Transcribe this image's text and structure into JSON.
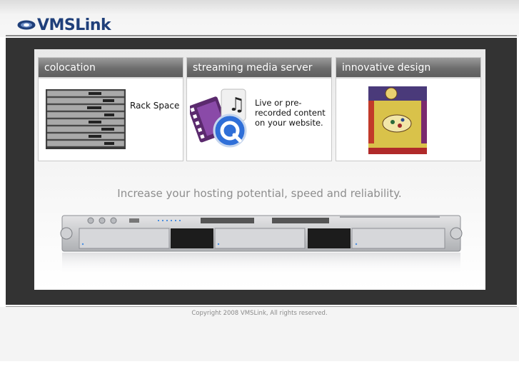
{
  "logo": {
    "text": "VMSLink"
  },
  "boxes": [
    {
      "title": "colocation",
      "caption": "Rack Space"
    },
    {
      "title": "streaming media server",
      "caption": "Live or pre-recorded content on your website."
    },
    {
      "title": "innovative design",
      "caption": ""
    }
  ],
  "tagline": "Increase your hosting potential, speed and reliability.",
  "footer": {
    "copyright": "Copyright 2008 VMSLink, All rights reserved."
  }
}
